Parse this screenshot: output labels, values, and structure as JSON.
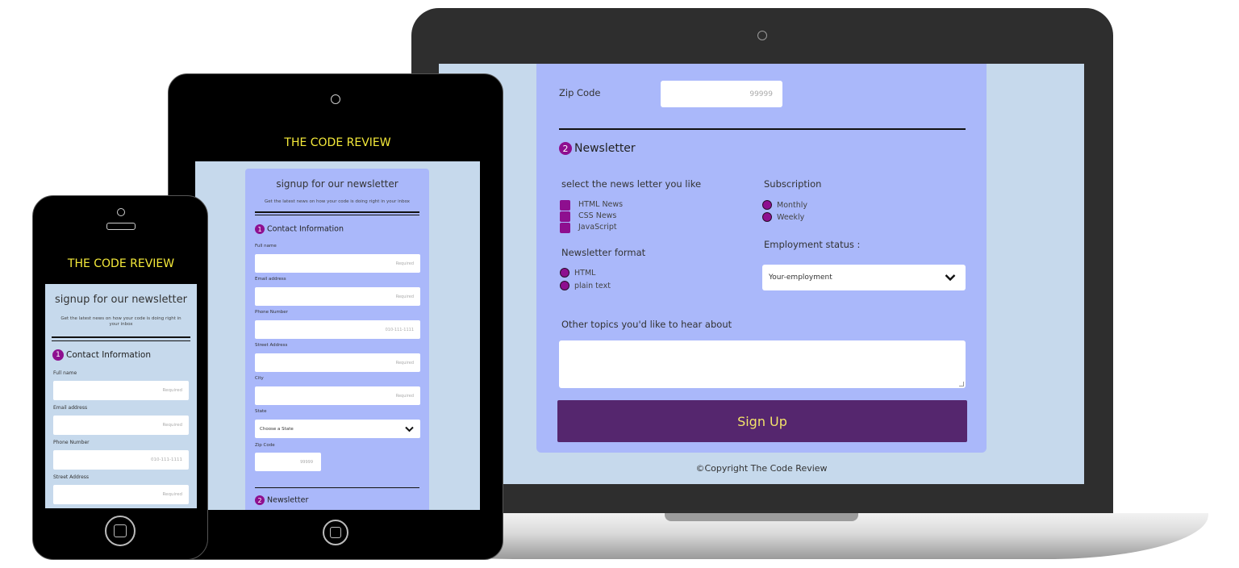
{
  "brand": {
    "title": "THE CODE REVIEW",
    "title_color": "#f5ea3a",
    "header_bg": "#000000"
  },
  "colors": {
    "page_bg": "#c6d9ec",
    "panel": "#aab8fa",
    "accent": "#8e0f8f",
    "button": "#55266e",
    "button_text": "#f2e36a"
  },
  "laptop": {
    "zip": {
      "label": "Zip Code",
      "placeholder": "99999"
    },
    "newsletter": {
      "step": "2",
      "heading": "Newsletter",
      "select_label": "select the news letter you like",
      "options": [
        "HTML News",
        "CSS News",
        "JavaScript"
      ],
      "format_label": "Newsletter format",
      "formats": [
        "HTML",
        "plain text"
      ],
      "subscription_label": "Subscription",
      "subscriptions": [
        "Monthly",
        "Weekly"
      ],
      "employment_label": "Employment status :",
      "employment_value": "Your-employment",
      "topics_label": "Other topics you'd like to hear about"
    },
    "submit": "Sign Up",
    "footer": "©Copyright The Code Review"
  },
  "tablet": {
    "title": "signup for our newsletter",
    "subtitle": "Get the latest news on how your code is doing right in your inbox",
    "contact": {
      "step": "1",
      "heading": "Contact Information"
    },
    "fields": [
      {
        "label": "Full name",
        "placeholder": "Required"
      },
      {
        "label": "Email address",
        "placeholder": "Required"
      },
      {
        "label": "Phone Number",
        "placeholder": "010-111-1111"
      },
      {
        "label": "Street Address",
        "placeholder": "Required"
      },
      {
        "label": "City",
        "placeholder": "Required"
      }
    ],
    "state": {
      "label": "State",
      "value": "Choose a State"
    },
    "zip": {
      "label": "Zip Code",
      "placeholder": "99999"
    },
    "newsletter": {
      "step": "2",
      "heading": "Newsletter"
    }
  },
  "phone": {
    "title": "signup for our newsletter",
    "subtitle": "Get the latest news on how your code is doing right in your inbox",
    "contact": {
      "step": "1",
      "heading": "Contact Information"
    },
    "fields": [
      {
        "label": "Full name",
        "placeholder": "Required"
      },
      {
        "label": "Email address",
        "placeholder": "Required"
      },
      {
        "label": "Phone Number",
        "placeholder": "010-111-1111"
      },
      {
        "label": "Street Address",
        "placeholder": "Required"
      }
    ]
  }
}
